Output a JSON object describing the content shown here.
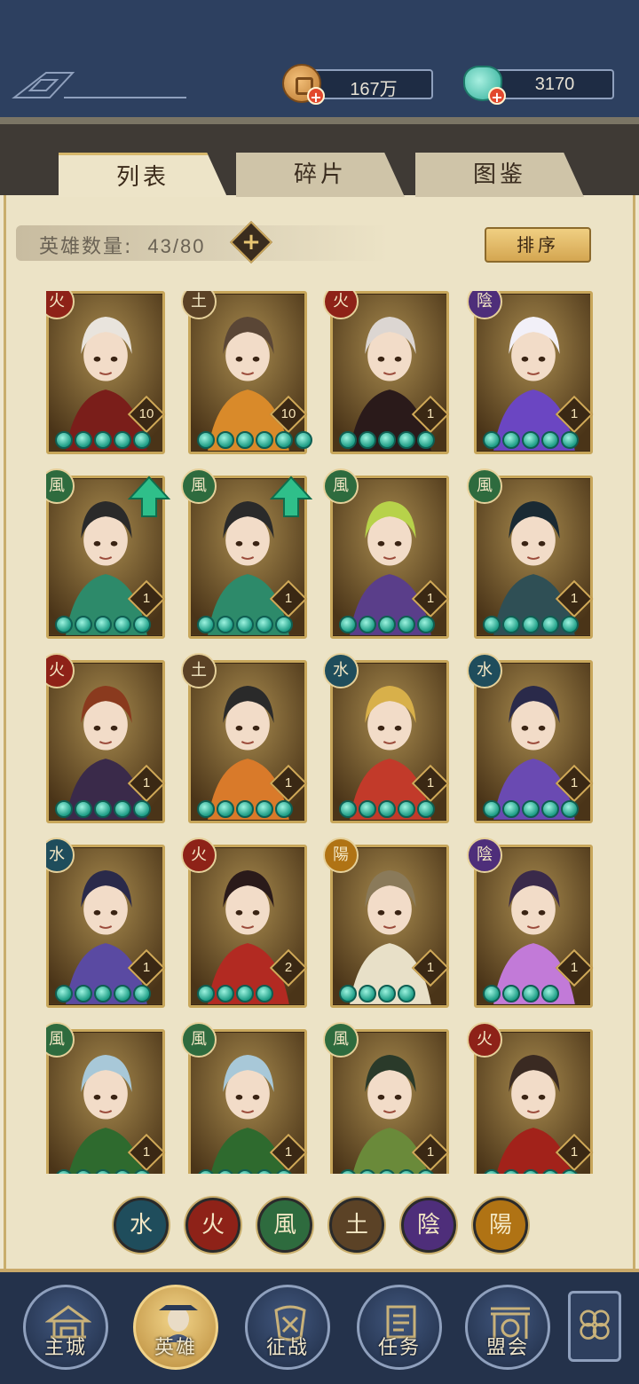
{
  "currency": {
    "coins": "167万",
    "jade": "3170"
  },
  "tabs": [
    {
      "label": "列表",
      "active": true
    },
    {
      "label": "碎片",
      "active": false
    },
    {
      "label": "图鉴",
      "active": false
    }
  ],
  "hero_count": {
    "label": "英雄数量:",
    "value": "43/80"
  },
  "sort_button": "排序",
  "elements": {
    "fire": {
      "glyph": "火",
      "color": "#8e2218"
    },
    "earth": {
      "glyph": "土",
      "color": "#5b4226"
    },
    "wind": {
      "glyph": "風",
      "color": "#2e6b3e"
    },
    "water": {
      "glyph": "水",
      "color": "#1f4d5c"
    },
    "yin": {
      "glyph": "陰",
      "color": "#4e2e7a"
    },
    "yang": {
      "glyph": "陽",
      "color": "#b07314"
    }
  },
  "heroes": [
    {
      "element": "fire",
      "level": "10",
      "stars": 5,
      "upgrade": false,
      "palette": [
        "#7a1e1a",
        "#e9e4dd"
      ]
    },
    {
      "element": "earth",
      "level": "10",
      "stars": 6,
      "upgrade": false,
      "palette": [
        "#d98a2a",
        "#5a4636"
      ]
    },
    {
      "element": "fire",
      "level": "1",
      "stars": 5,
      "upgrade": false,
      "palette": [
        "#2a1a1a",
        "#dcd6d2"
      ]
    },
    {
      "element": "yin",
      "level": "1",
      "stars": 5,
      "upgrade": false,
      "palette": [
        "#6b46c2",
        "#f2f0f8"
      ]
    },
    {
      "element": "wind",
      "level": "1",
      "stars": 5,
      "upgrade": true,
      "palette": [
        "#2d8a6a",
        "#2a2a2a"
      ]
    },
    {
      "element": "wind",
      "level": "1",
      "stars": 5,
      "upgrade": true,
      "palette": [
        "#2d8a6a",
        "#2a2a2a"
      ]
    },
    {
      "element": "wind",
      "level": "1",
      "stars": 5,
      "upgrade": false,
      "palette": [
        "#5a3e8a",
        "#b7d24a"
      ]
    },
    {
      "element": "wind",
      "level": "1",
      "stars": 5,
      "upgrade": false,
      "palette": [
        "#2f4f55",
        "#1a2a33"
      ]
    },
    {
      "element": "fire",
      "level": "1",
      "stars": 5,
      "upgrade": false,
      "palette": [
        "#3a2a4a",
        "#8a3a1e"
      ]
    },
    {
      "element": "earth",
      "level": "1",
      "stars": 5,
      "upgrade": false,
      "palette": [
        "#d97a2a",
        "#2a2a2a"
      ]
    },
    {
      "element": "water",
      "level": "1",
      "stars": 5,
      "upgrade": false,
      "palette": [
        "#c23a2a",
        "#d8b04a"
      ]
    },
    {
      "element": "water",
      "level": "1",
      "stars": 5,
      "upgrade": false,
      "palette": [
        "#6a4ab2",
        "#2a2a4a"
      ]
    },
    {
      "element": "water",
      "level": "1",
      "stars": 5,
      "upgrade": false,
      "palette": [
        "#5a4aa2",
        "#2a2a4a"
      ]
    },
    {
      "element": "fire",
      "level": "2",
      "stars": 4,
      "upgrade": false,
      "palette": [
        "#b22a22",
        "#2a1a1a"
      ]
    },
    {
      "element": "yang",
      "level": "1",
      "stars": 4,
      "upgrade": false,
      "palette": [
        "#e8e0c8",
        "#8a7a5a"
      ]
    },
    {
      "element": "yin",
      "level": "1",
      "stars": 4,
      "upgrade": false,
      "palette": [
        "#c27ad8",
        "#3a2a4a"
      ]
    },
    {
      "element": "wind",
      "level": "1",
      "stars": 5,
      "upgrade": false,
      "palette": [
        "#2e6a2e",
        "#a8c8d8"
      ]
    },
    {
      "element": "wind",
      "level": "1",
      "stars": 5,
      "upgrade": false,
      "palette": [
        "#2e6a2e",
        "#a8c8d8"
      ]
    },
    {
      "element": "wind",
      "level": "1",
      "stars": 5,
      "upgrade": false,
      "palette": [
        "#6a8a3a",
        "#2a3a2a"
      ]
    },
    {
      "element": "fire",
      "level": "1",
      "stars": 5,
      "upgrade": false,
      "palette": [
        "#a2221a",
        "#3a2a22"
      ]
    }
  ],
  "filters": [
    "water",
    "fire",
    "wind",
    "earth",
    "yin",
    "yang"
  ],
  "nav": [
    {
      "label": "主城",
      "icon": "palace-icon",
      "active": false
    },
    {
      "label": "英雄",
      "icon": "hero-portrait-icon",
      "active": true
    },
    {
      "label": "征战",
      "icon": "battle-icon",
      "active": false
    },
    {
      "label": "任务",
      "icon": "task-scroll-icon",
      "active": false
    },
    {
      "label": "盟会",
      "icon": "guild-gate-icon",
      "active": false
    }
  ]
}
